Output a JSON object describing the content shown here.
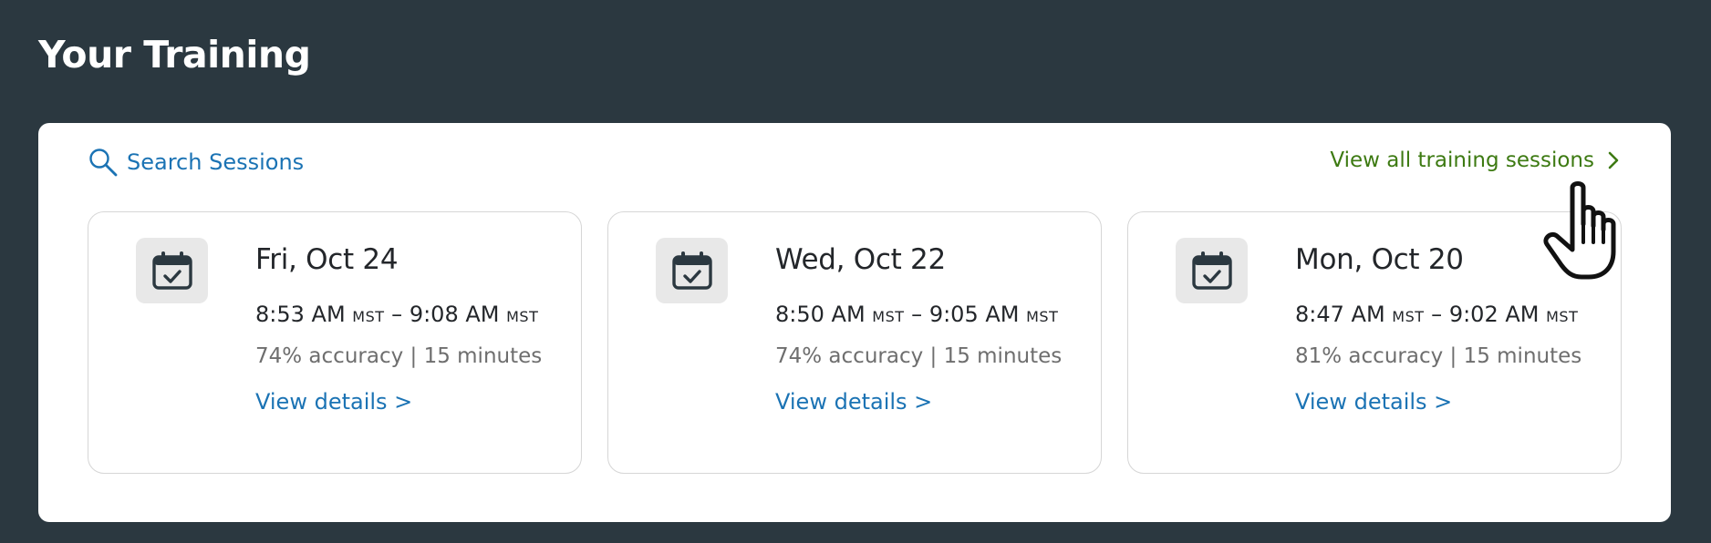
{
  "header": {
    "title": "Your Training"
  },
  "panel": {
    "search_label": "Search Sessions",
    "view_all_label": "View all training sessions"
  },
  "sessions": [
    {
      "date": "Fri, Oct 24",
      "start": "8:53 AM",
      "end": "9:08 AM",
      "tz": "MST",
      "separator": "–",
      "stats": "74% accuracy | 15 minutes",
      "link": "View details >"
    },
    {
      "date": "Wed, Oct 22",
      "start": "8:50 AM",
      "end": "9:05 AM",
      "tz": "MST",
      "separator": "–",
      "stats": "74% accuracy | 15 minutes",
      "link": "View details >"
    },
    {
      "date": "Mon, Oct 20",
      "start": "8:47 AM",
      "end": "9:02 AM",
      "tz": "MST",
      "separator": "–",
      "stats": "81% accuracy | 15 minutes",
      "link": "View details >"
    }
  ],
  "colors": {
    "page_background": "#2b3840",
    "link_blue": "#1b73b4",
    "link_green": "#3d7a12",
    "icon_background": "#e8e8e8"
  },
  "icons": {
    "search": "search-icon",
    "view_all": "chevron-right-icon",
    "session": "calendar-check-icon",
    "cursor": "hand-pointer-cursor"
  }
}
